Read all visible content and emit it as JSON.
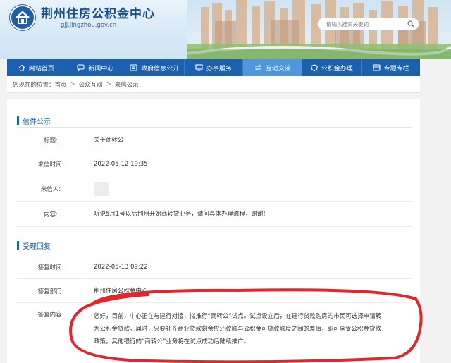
{
  "header": {
    "site_name": "荆州住房公积金中心",
    "site_url": "gjj.jingzhou.gov.cn",
    "search_placeholder": "请输入搜索关键词"
  },
  "nav": {
    "items": [
      {
        "label": "网站首页",
        "icon": "home-icon"
      },
      {
        "label": "新闻中心",
        "icon": "chat-icon"
      },
      {
        "label": "政府信息公开",
        "icon": "info-icon"
      },
      {
        "label": "办事服务",
        "icon": "monitor-icon"
      },
      {
        "label": "互动交流",
        "icon": "exchange-icon",
        "active": true
      },
      {
        "label": "公积金办理",
        "icon": "shield-icon"
      },
      {
        "label": "专题专栏",
        "icon": "column-icon"
      }
    ]
  },
  "breadcrumb": {
    "prefix": "您现在的位置：",
    "items": [
      "首页",
      "公众互动",
      "来信公示"
    ]
  },
  "letter": {
    "section_title": "信件公示",
    "title_label": "标题:",
    "title_value": "关于商转公",
    "time_label": "来信时间:",
    "time_value": "2022-05-12 19:35",
    "sender_label": "来信人:",
    "content_label": "内容:",
    "content_value": "听说5月1号以后荆州开始商转贷业务，请问具体办理流程，谢谢!"
  },
  "reply": {
    "section_title": "受理回复",
    "time_label": "答复时间:",
    "time_value": "2022-05-13 09:22",
    "dept_label": "答复部门:",
    "dept_value": "荆州住房公积金中心",
    "content_label": "答复内容:",
    "content_value": "您好，目前，中心正在与建行对接，拟推行“商转公”试点。试点设立后，在建行贷款购房的市民可选择申请转为公积金贷款。届时，只要补齐商业贷款剩余应还款额与公积金可贷款额度之间的差值，即可享受公积金贷款政策。其他银行的“商转公”业务将在试点成功后陆续推广。"
  },
  "colors": {
    "nav_bg": "#1c61ad",
    "nav_active": "#4f97dd",
    "accent": "#1c61ad",
    "annotation": "#e3262b"
  }
}
